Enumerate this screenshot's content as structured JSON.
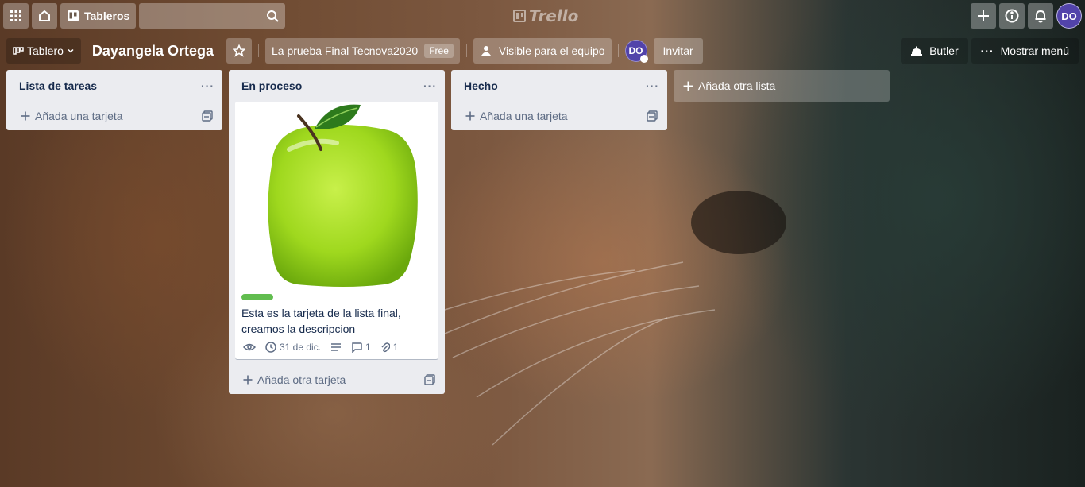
{
  "header": {
    "boards_label": "Tableros",
    "logo_text": "Trello",
    "avatar_initials": "DO"
  },
  "board": {
    "view_label": "Tablero",
    "title": "Dayangela Ortega",
    "team_name": "La prueba Final Tecnova2020",
    "team_badge": "Free",
    "visibility_label": "Visible para el equipo",
    "member_initials": "DO",
    "invite_label": "Invitar",
    "butler_label": "Butler",
    "menu_label": "Mostrar menú"
  },
  "lists": [
    {
      "title": "Lista de tareas",
      "add_card_label": "Añada una tarjeta"
    },
    {
      "title": "En proceso",
      "add_card_label": "Añada otra tarjeta",
      "cards": [
        {
          "label_color": "#61bd4f",
          "text": "Esta es la tarjeta de la lista final, creamos la descripcion",
          "due": "31 de dic.",
          "comments": "1",
          "attachments": "1"
        }
      ]
    },
    {
      "title": "Hecho",
      "add_card_label": "Añada una tarjeta"
    }
  ],
  "add_list_label": "Añada otra lista",
  "colors": {
    "list_bg": "#ebecf0",
    "label_green": "#61bd4f",
    "avatar_purple": "#5243aa"
  }
}
